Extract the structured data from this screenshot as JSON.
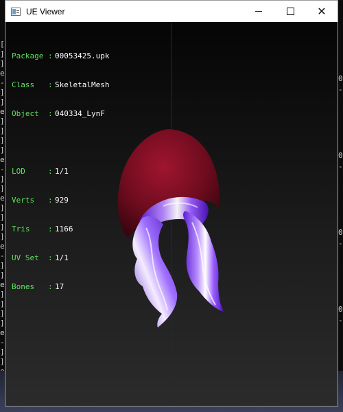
{
  "window": {
    "title": "UE Viewer",
    "controls": {
      "minimize_icon": "minimize-icon",
      "maximize_icon": "maximize-icon",
      "close_label": "✕"
    }
  },
  "info": {
    "package_label": "Package",
    "package": "00053425.upk",
    "class_label": "Class",
    "class": "SkeletalMesh",
    "object_label": "Object",
    "object": "040334_LynF",
    "lod_label": "LOD",
    "lod": "1/1",
    "verts_label": "Verts",
    "verts": "929",
    "tris_label": "Tris",
    "tris": "1166",
    "uvset_label": "UV Set",
    "uvset": "1/1",
    "bones_label": "Bones",
    "bones": "17"
  },
  "colors": {
    "info_label": "#5fe35f",
    "info_value": "#ffffff",
    "axis": "#1414d0",
    "hood": "#7a0f22",
    "hair": "#8a3bff"
  },
  "background_console": {
    "left_glyphs": [
      "[",
      "]",
      "]",
      "e",
      "-",
      "]",
      "]",
      "e",
      "]",
      "]",
      "]",
      "]",
      "e",
      "-",
      "]",
      "]",
      "e",
      "]",
      "]",
      "]",
      "]",
      "e",
      "-",
      "]",
      "]",
      "e",
      "]",
      "]",
      "]",
      "]",
      "e",
      "-",
      "]",
      "]",
      "e",
      "]"
    ],
    "right_glyphs": [
      "0",
      "-",
      "0",
      "-",
      "0",
      "-",
      "0",
      "-"
    ]
  }
}
